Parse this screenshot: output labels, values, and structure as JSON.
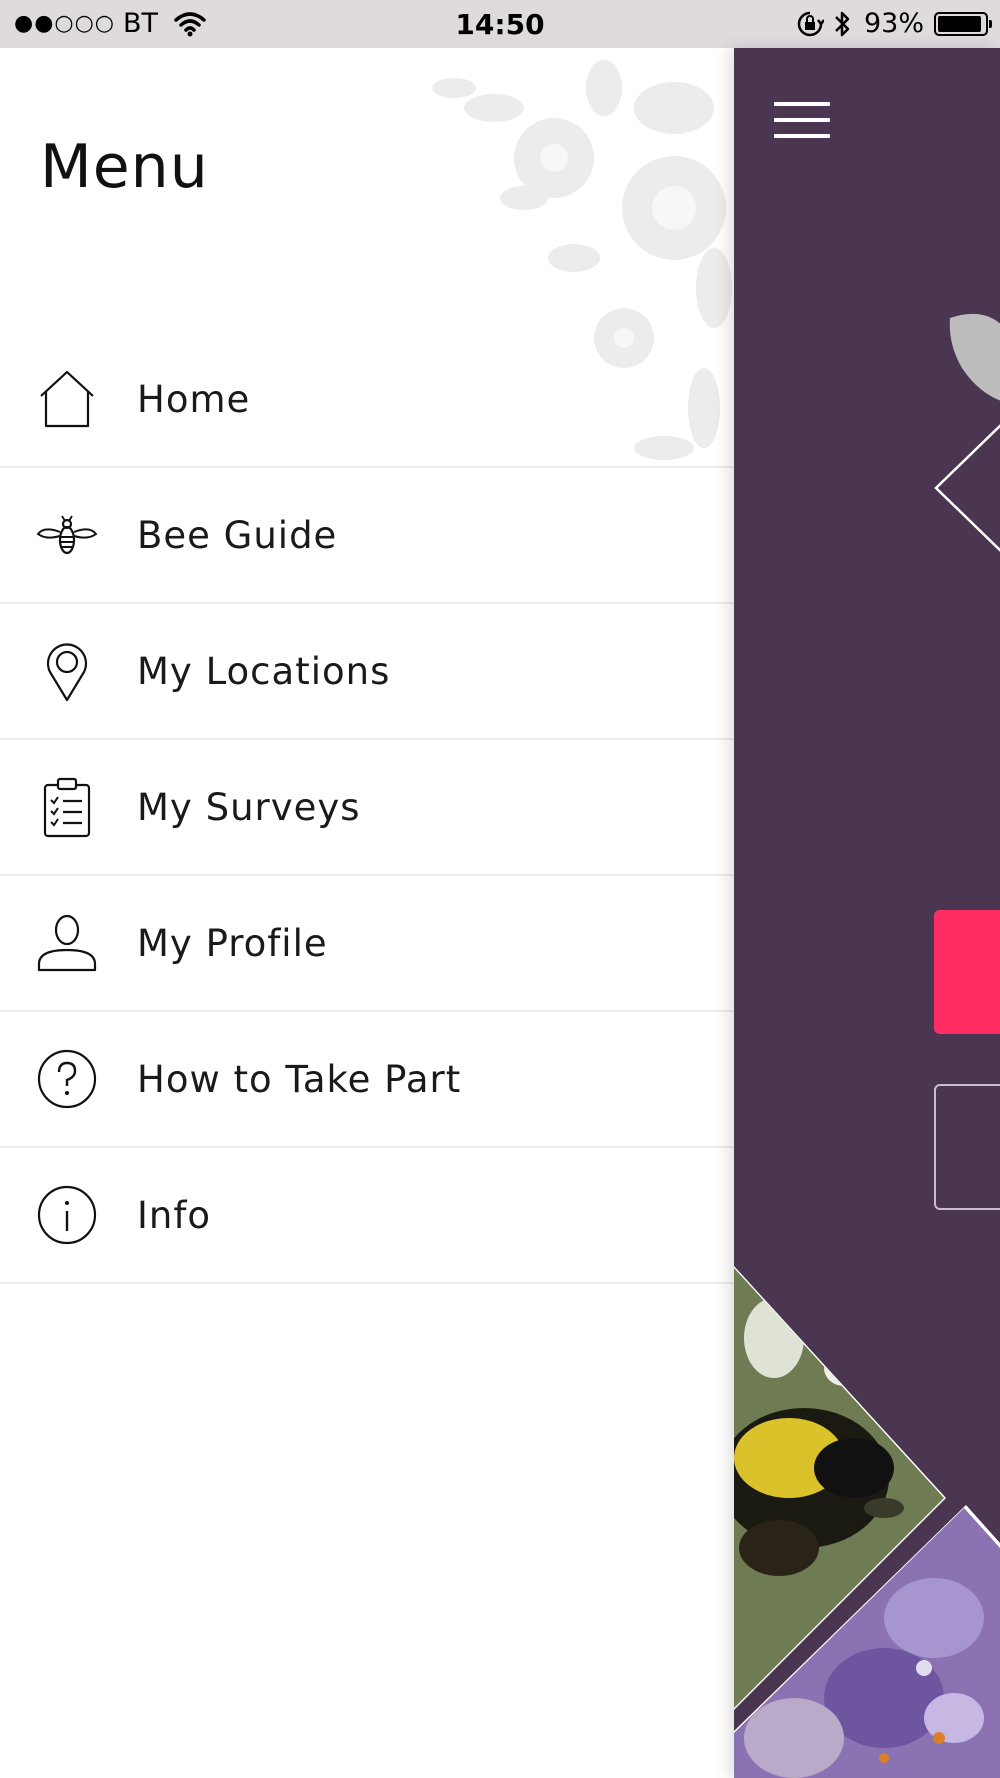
{
  "status_bar": {
    "signal": "●●○○○",
    "carrier": "BT",
    "time": "14:50",
    "battery_percent_text": "93%",
    "battery_level": 0.93
  },
  "menu": {
    "title": "Menu",
    "items": [
      {
        "label": "Home",
        "icon": "home-icon"
      },
      {
        "label": "Bee Guide",
        "icon": "bee-icon"
      },
      {
        "label": "My Locations",
        "icon": "location-pin-icon"
      },
      {
        "label": "My Surveys",
        "icon": "clipboard-checklist-icon"
      },
      {
        "label": "My Profile",
        "icon": "person-icon"
      },
      {
        "label": "How to Take Part",
        "icon": "question-circle-icon"
      },
      {
        "label": "Info",
        "icon": "info-circle-icon"
      }
    ]
  },
  "colors": {
    "panel_background": "#4a3650",
    "primary_button": "#ff2d63",
    "divider": "#ececec",
    "status_bar": "#dedade"
  }
}
